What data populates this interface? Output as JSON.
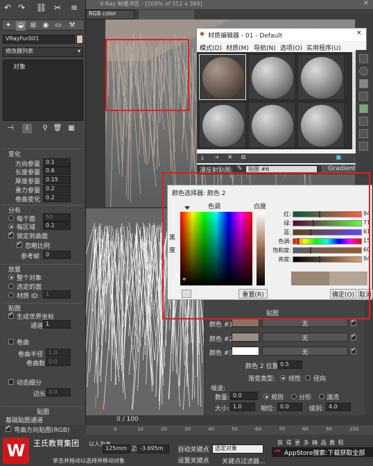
{
  "viewport_top": {
    "title": "V-Ray 帧缓冲区 - [100% of 512 x 384]",
    "channel": "RGB color"
  },
  "left_panel": {
    "object_name": "VRayFur001",
    "modifier_list": "修改器列表",
    "object_label": "对象",
    "sections": {
      "change": {
        "title": "变化",
        "params": [
          {
            "label": "方向参量",
            "value": "0.1"
          },
          {
            "label": "长度参量",
            "value": "0.6"
          },
          {
            "label": "厚度参量",
            "value": "0.15"
          },
          {
            "label": "重力参量",
            "value": "0.2"
          },
          {
            "label": "卷曲变化",
            "value": "0.2"
          }
        ]
      },
      "distribution": {
        "title": "分布",
        "per_face": "每个面",
        "per_face_value": "50",
        "per_area": "每区域",
        "per_area_value": "0.1",
        "lock_to_surface": "锁定到曲面",
        "ignore_scale": "忽略比例",
        "ref_frame": "参考帧",
        "ref_frame_value": "0"
      },
      "placement": {
        "title": "放置",
        "whole_object": "整个对象",
        "selected_faces": "选定的面",
        "material_id": "材质 ID",
        "material_id_value": "1"
      },
      "mapping": {
        "title": "贴图",
        "gen_world_coords": "生成世界坐标",
        "channel": "通道",
        "channel_value": "1"
      },
      "curl": {
        "title": "卷曲",
        "curl_radius": "卷曲半径",
        "curl_radius_value": "1.0",
        "curl_count": "卷曲数",
        "curl_count_value": "0.0"
      },
      "dyn_subdiv": {
        "title": "动态细分",
        "edge": "边长",
        "edge_value": "4.0"
      },
      "maps": {
        "title": "贴图",
        "base_map_channel": "基础贴图通道",
        "bend_direction": "弯曲方向贴图(RGB)"
      }
    }
  },
  "material_editor": {
    "title": "材质编辑器 - 01 - Default",
    "menu": [
      "模式(D)",
      "材质(M)",
      "导航(N)",
      "选项(O)",
      "实用程序(U)"
    ],
    "map_label": "漫反射贴图:",
    "map_value": "贴图 #6",
    "map_type": "Gradient"
  },
  "color_picker": {
    "title": "颜色选择器: 颜色 2",
    "hue_label": "色调",
    "white_label": "白度",
    "black_label": "黑",
    "degree_label": "度",
    "channels": [
      {
        "label": "红:",
        "value": "94"
      },
      {
        "label": "绿:",
        "value": "71"
      },
      {
        "label": "蓝:",
        "value": "61"
      },
      {
        "label": "色调:",
        "value": "15"
      },
      {
        "label": "饱和度:",
        "value": "60"
      },
      {
        "label": "亮度:",
        "value": "94"
      }
    ],
    "reset": "重置(R)",
    "ok": "确定(O)",
    "cancel": "取消"
  },
  "gradient_params": {
    "header": "贴图",
    "rows": [
      {
        "label": "颜色 #1",
        "map": "无",
        "color": "#8a7264"
      },
      {
        "label": "颜色 #2",
        "map": "无",
        "color": "#9b8e86"
      },
      {
        "label": "颜色 #3",
        "map": "无",
        "color": "#ffffff"
      }
    ],
    "color2_pos_label": "颜色 2 位置:",
    "color2_pos_value": "0.5",
    "grad_type_label": "渐变类型:",
    "grad_linear": "线性",
    "grad_radial": "径向",
    "noise_title": "噪波:",
    "amount_label": "数量:",
    "amount_value": "0.0",
    "regular": "规则",
    "fractal": "分形",
    "turbulence": "湍流",
    "size_label": "大小:",
    "size_value": "1.0",
    "phase_label": "相位:",
    "phase_value": "0.0",
    "levels_label": "级别:",
    "levels_value": "4.0"
  },
  "timeline": {
    "frame": "0 / 100",
    "ticks": [
      "0",
      "10",
      "20",
      "30",
      "40",
      "50",
      "60",
      "70",
      "80",
      "90",
      "100"
    ]
  },
  "status_bar": {
    "y_label": "Y:",
    "y_value": "125mm",
    "z_label": "Z:",
    "z_value": "-3.695m",
    "auto_key": "自动关键点",
    "set_key": "设置关键点",
    "selection": "选定对象",
    "key_filter": "关键点过滤器...",
    "prompt": "单击并拖动以选择并移动对象",
    "logo_text": "王氏教育集团",
    "logo_sub": "以人为本",
    "watermark": "AppStore搜索:下载获取全部",
    "watermark_top": "获 得 更 多 精 品 教 程"
  },
  "colors": {
    "accent_red": "#e0201a",
    "panel_bg": "#444444",
    "dialog_bg": "#f0f0f0"
  }
}
